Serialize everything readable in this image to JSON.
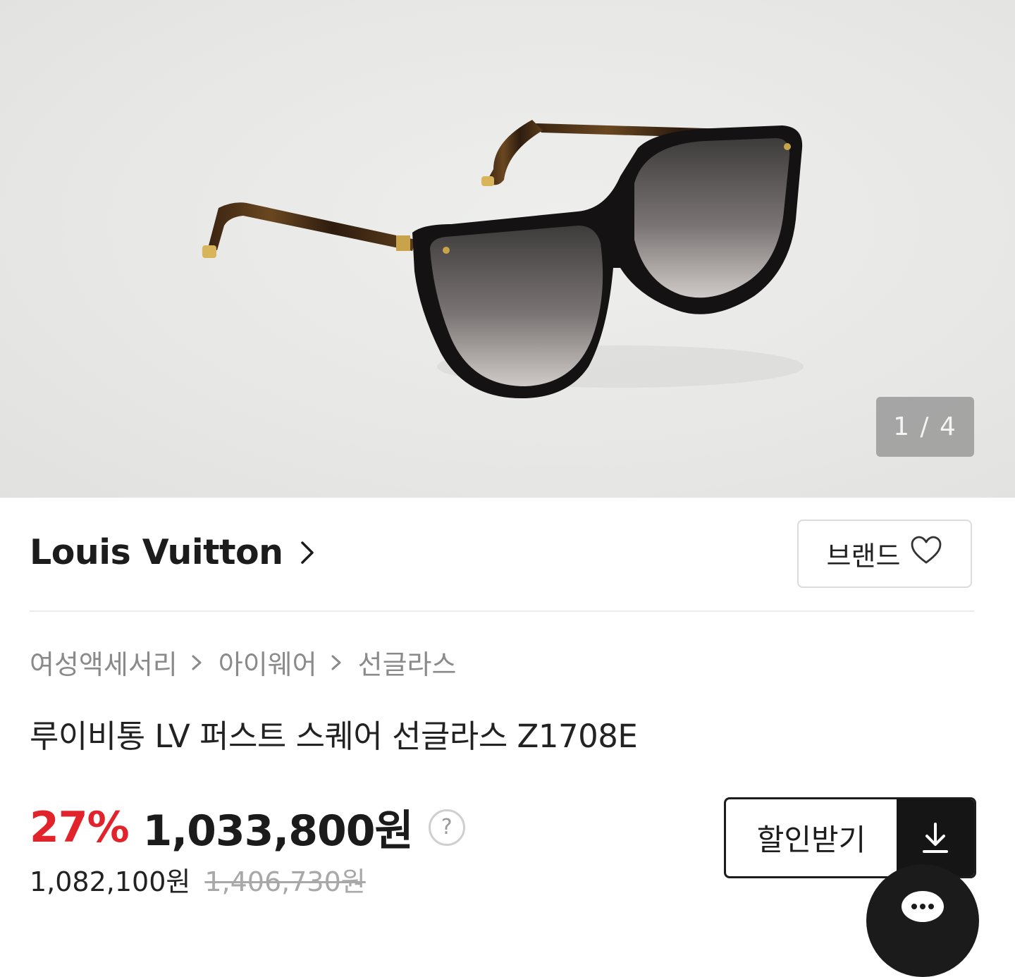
{
  "gallery": {
    "counter": "1 / 4",
    "image_alt": "sunglasses"
  },
  "brand": {
    "name": "Louis Vuitton",
    "follow_label": "브랜드"
  },
  "breadcrumb": {
    "items": [
      "여성액세서리",
      "아이웨어",
      "선글라스"
    ]
  },
  "product": {
    "title": "루이비통 LV 퍼스트 스퀘어 선글라스 Z1708E",
    "discount": "27%",
    "price": "1,033,800원",
    "member_price": "1,082,100원",
    "original_price": "1,406,730원"
  },
  "coupon": {
    "label": "할인받기"
  },
  "colors": {
    "accent_red": "#e1242c",
    "dark": "#151515"
  }
}
